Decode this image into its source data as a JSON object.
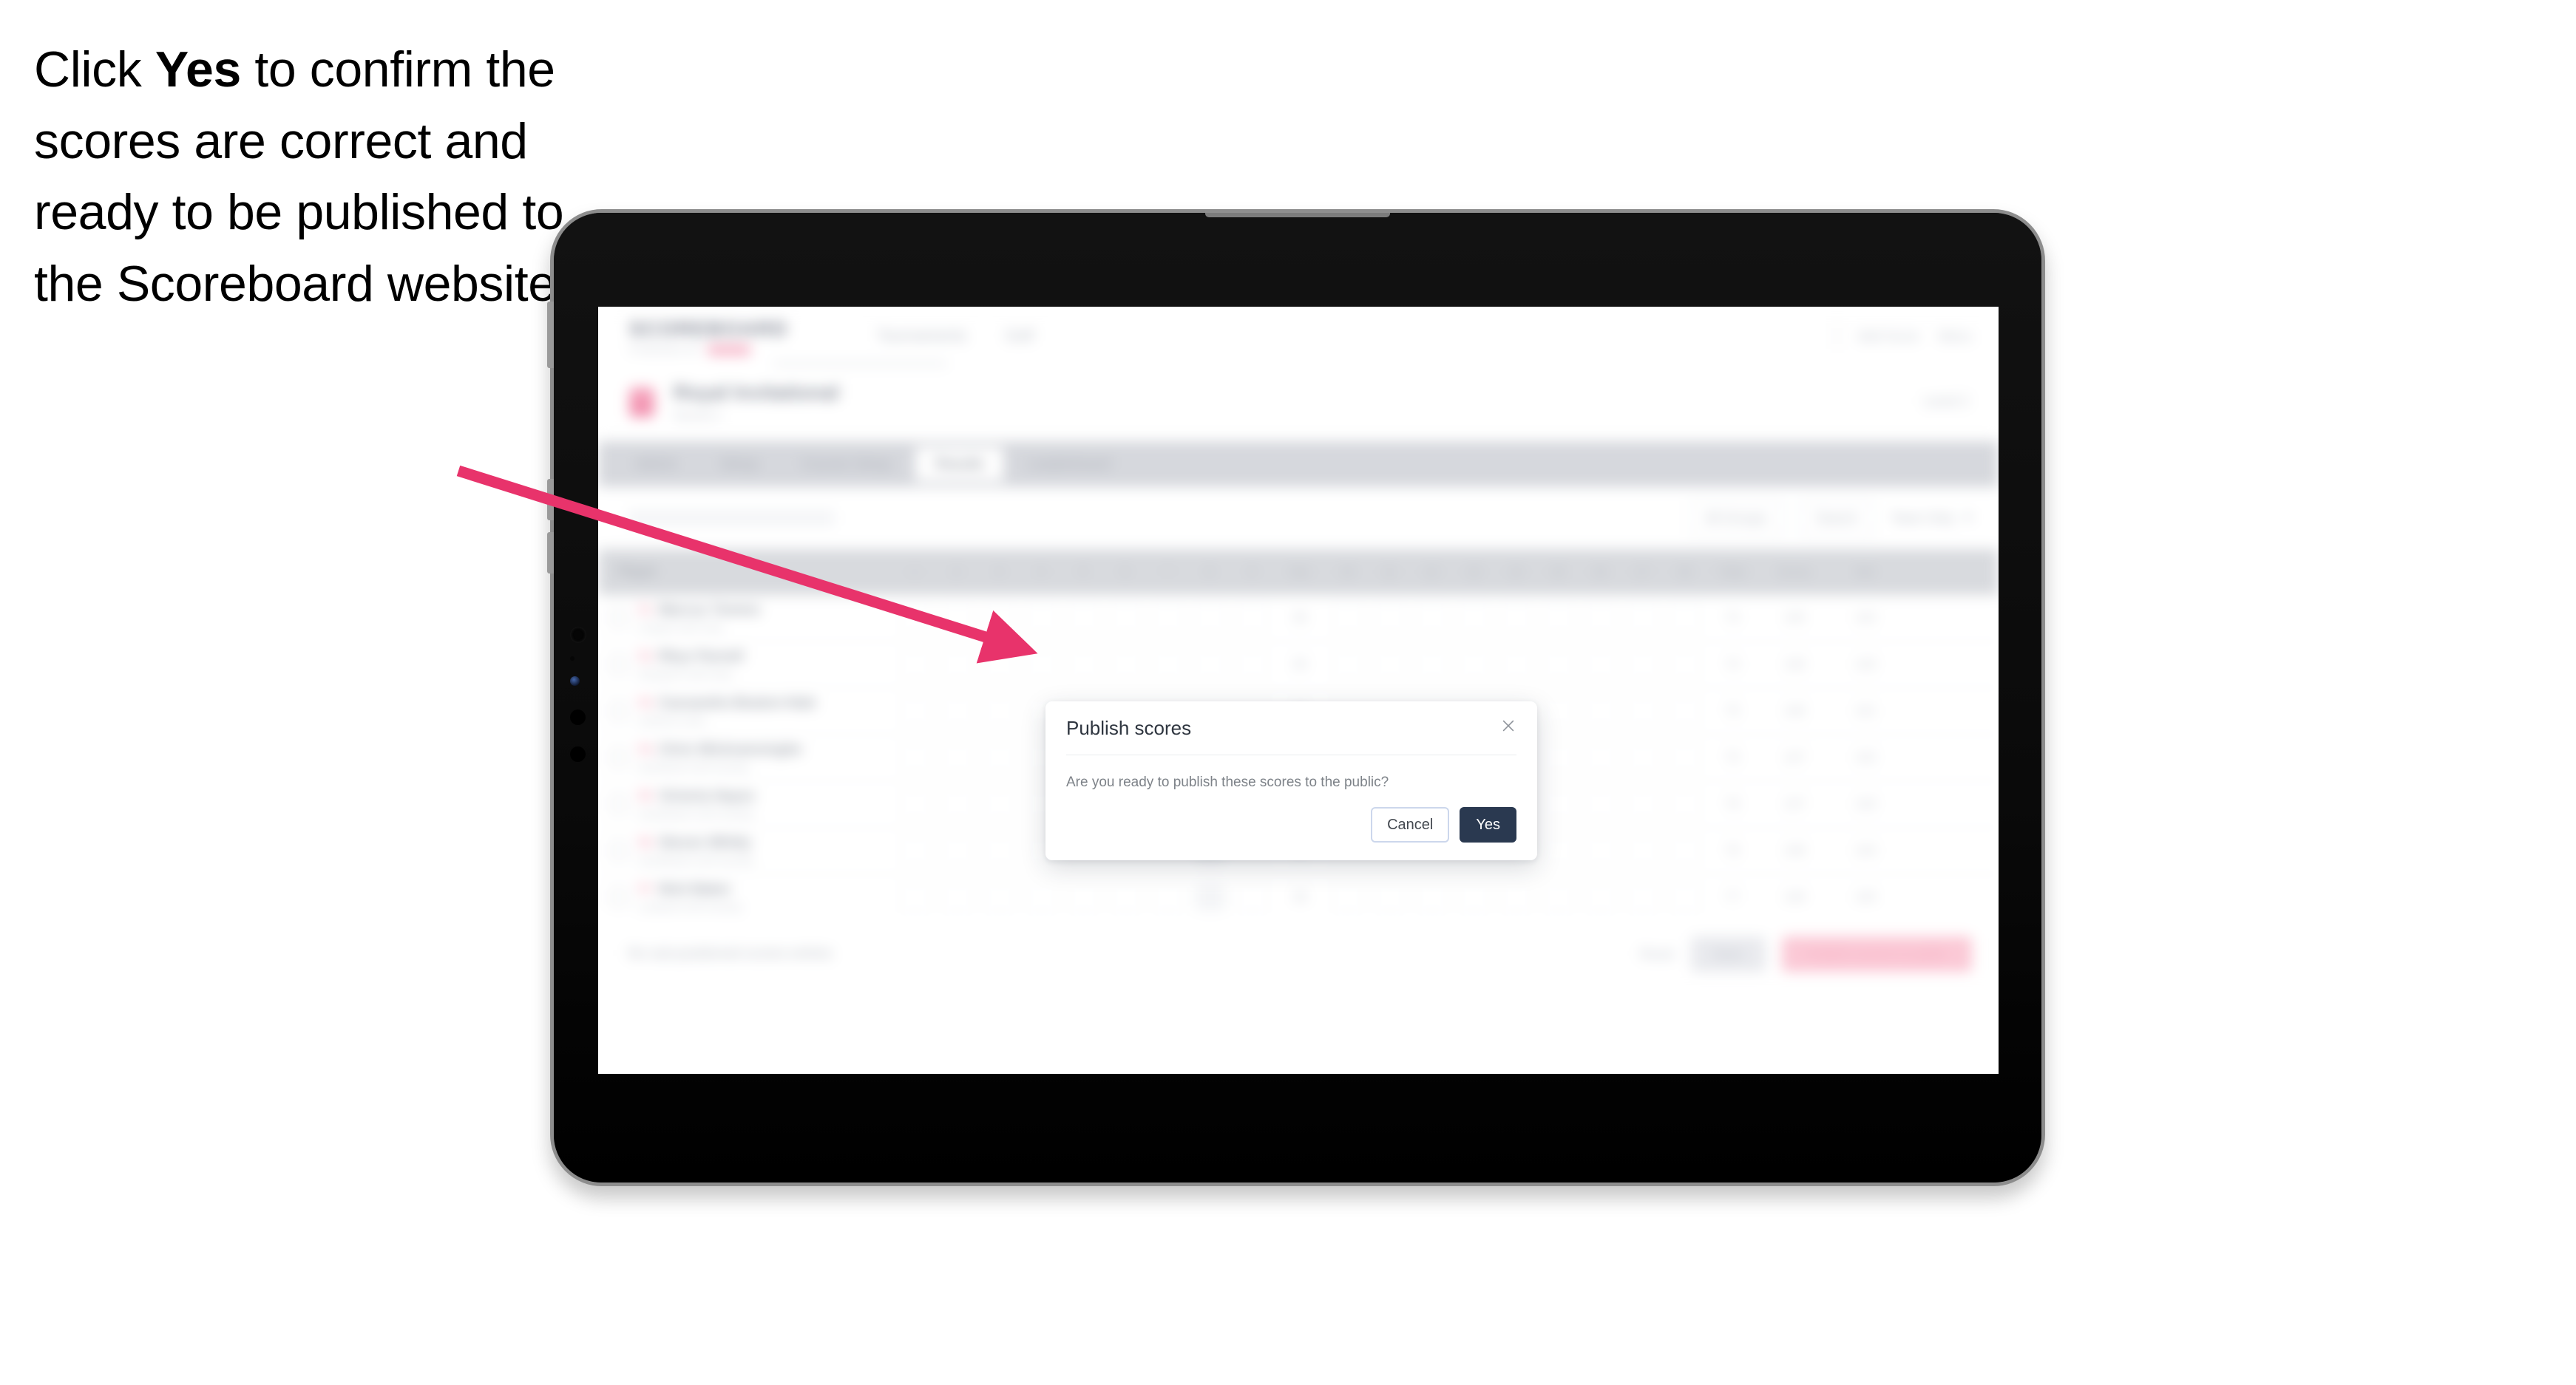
{
  "annotation": {
    "text_parts": {
      "before": "Click ",
      "emphasis": "Yes",
      "after": " to confirm the scores are correct and ready to be published to the Scoreboard website."
    },
    "arrow_color": "#E8336B"
  },
  "device": {
    "type": "tablet",
    "body_color": "#0b0b0b",
    "bezel_color": "#8d8d8d"
  },
  "app": {
    "brand": {
      "word": "SCOREBOARD",
      "subtitle": "POWERED BY"
    },
    "nav": [
      "Tournaments",
      "Golf"
    ],
    "header_right": [
      "Add Score",
      "Menu"
    ],
    "event": {
      "title": "Royal Invitational",
      "meta": "Round 2",
      "right_label": "Level 2"
    },
    "tabs": [
      {
        "label": "Admin",
        "active": false
      },
      {
        "label": "Setup",
        "active": false
      },
      {
        "label": "Course Setup",
        "active": false
      },
      {
        "label": "Results",
        "active": true
      },
      {
        "label": "Leaderboard",
        "active": false
      }
    ],
    "toolbar": {
      "filter_label": "All Groups",
      "search_placeholder": "Search",
      "sort_label": "Team Only"
    },
    "table": {
      "columns": {
        "player": "Player",
        "holes": [
          "1",
          "2",
          "3",
          "4",
          "5",
          "6",
          "7",
          "8",
          "9",
          "10",
          "11",
          "12",
          "13",
          "14",
          "15",
          "16",
          "17",
          "18"
        ],
        "out": "Out",
        "total": "Total",
        "gross": "Gross",
        "net": "Net"
      },
      "rows": [
        {
          "badge": "T1",
          "name": "Marcus Tomms",
          "club": "Chapel Golf Club",
          "out": "36",
          "total": "74",
          "gross": "145",
          "net": "142"
        },
        {
          "badge": "T2",
          "name": "Rhys Parnell",
          "club": "Westport Golf Club",
          "out": "36",
          "total": "74",
          "gross": "146",
          "net": "143"
        },
        {
          "badge": "T3",
          "name": "Cassandra Beaton-Hale",
          "club": "Ashford Links",
          "out": "36",
          "total": "75",
          "gross": "146",
          "net": "141"
        },
        {
          "badge": "T4",
          "name": "Chris Wickramsinghe",
          "club": "Northland Golf Society",
          "out": "37",
          "total": "75",
          "gross": "147",
          "net": "142"
        },
        {
          "badge": "T5",
          "name": "Victoria Hayes",
          "club": "Southbank Golf Society",
          "out": "37",
          "total": "76",
          "gross": "147",
          "net": "143"
        },
        {
          "badge": "T6",
          "name": "Steven Whitty",
          "club": "Southbank Golf Society",
          "out": "38",
          "total": "76",
          "gross": "148",
          "net": "144"
        },
        {
          "badge": "T7",
          "name": "Nick Baker",
          "club": "Lowland Golf Society",
          "out": "38",
          "total": "77",
          "gross": "149",
          "net": "145"
        }
      ],
      "footer": {
        "note": "No sub-positioned scores entries",
        "link": "Reset",
        "secondary_button": "Save",
        "primary_button": "Publish scores to public"
      }
    }
  },
  "modal": {
    "title": "Publish scores",
    "body": "Are you ready to publish these scores to the public?",
    "cancel_label": "Cancel",
    "confirm_label": "Yes",
    "close_icon": "close-icon",
    "confirm_color": "#2a3950"
  }
}
